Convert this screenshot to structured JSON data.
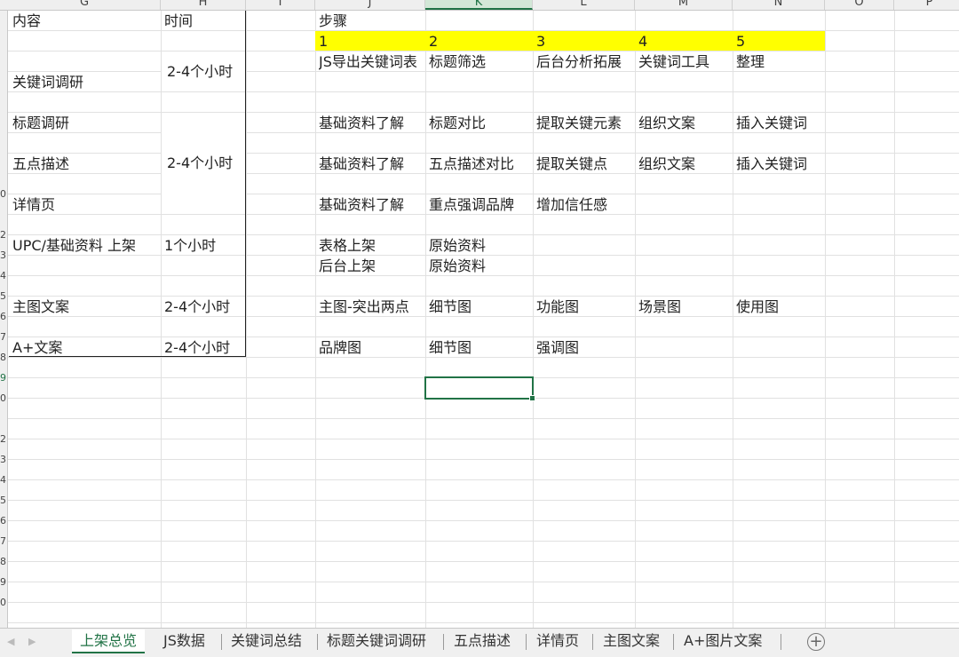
{
  "column_headers": [
    "G",
    "H",
    "I",
    "J",
    "K",
    "L",
    "M",
    "N",
    "O",
    "P"
  ],
  "row_headers": [
    "",
    "",
    "",
    "",
    "",
    "",
    "",
    "",
    "0",
    "",
    "2",
    "3",
    "4",
    "5",
    "6",
    "7",
    "8",
    "9",
    "0",
    "",
    "2",
    "3",
    "4",
    "5",
    "6",
    "7",
    "8",
    "9",
    "0"
  ],
  "table": {
    "header_content": "内容",
    "header_time": "时间",
    "rows": [
      {
        "label": "关键词调研",
        "time": "2-4个小时"
      },
      {
        "label": "标题调研",
        "time": ""
      },
      {
        "label": "五点描述",
        "time": "2-4个小时"
      },
      {
        "label": "详情页",
        "time": ""
      },
      {
        "label": "UPC/基础资料 上架",
        "time": "1个小时"
      },
      {
        "label": "主图文案",
        "time": "2-4个小时"
      },
      {
        "label": "A+文案",
        "time": "2-4个小时"
      }
    ]
  },
  "steps": {
    "title": "步骤",
    "numbers": [
      "1",
      "2",
      "3",
      "4",
      "5"
    ],
    "keyword_row": [
      "JS导出关键词表",
      "标题筛选",
      "后台分析拓展",
      "关键词工具",
      "整理"
    ],
    "title_row": [
      "基础资料了解",
      "标题对比",
      "提取关键元素",
      "组织文案",
      "插入关键词"
    ],
    "bullet_row": [
      "基础资料了解",
      "五点描述对比",
      "提取关键点",
      "组织文案",
      "插入关键词"
    ],
    "detail_row": [
      "基础资料了解",
      "重点强调品牌",
      "增加信任感"
    ],
    "upc_row_1": [
      "表格上架",
      "原始资料"
    ],
    "upc_row_2": [
      "后台上架",
      "原始资料"
    ],
    "main_image_row": [
      "主图-突出两点",
      "细节图",
      "功能图",
      "场景图",
      "使用图"
    ],
    "aplus_row": [
      "品牌图",
      "细节图",
      "强调图"
    ]
  },
  "sheet_tabs": [
    "上架总览",
    "JS数据",
    "关键词总结",
    "标题关键词调研",
    "五点描述",
    "详情页",
    "主图文案",
    "A+图片文案"
  ],
  "active_tab": "上架总览",
  "nav": {
    "prev": "◀",
    "next": "▶",
    "add": "+"
  },
  "colors": {
    "accent": "#217346",
    "highlight": "#ffff00",
    "gridline": "#e1e1e1"
  }
}
